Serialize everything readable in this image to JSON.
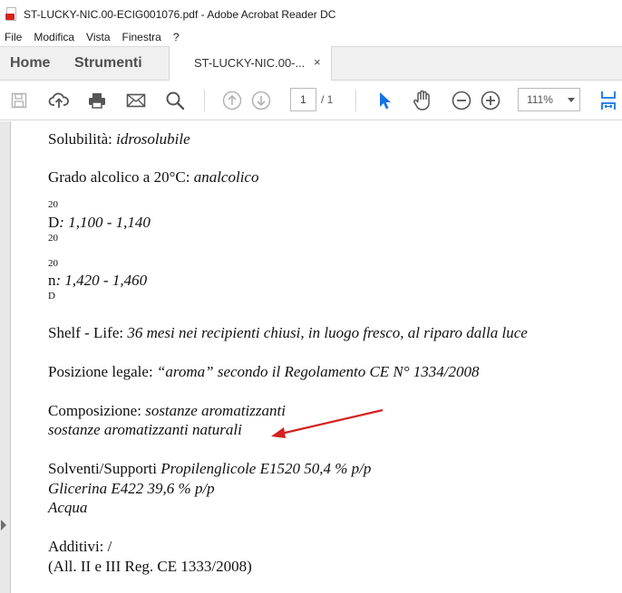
{
  "window": {
    "title": "ST-LUCKY-NIC.00-ECIG001076.pdf - Adobe Acrobat Reader DC"
  },
  "menu": [
    "File",
    "Modifica",
    "Vista",
    "Finestra",
    "?"
  ],
  "tabs": {
    "home": "Home",
    "tools": "Strumenti",
    "document": "ST-LUCKY-NIC.00-...",
    "close": "×"
  },
  "toolbar": {
    "icons": [
      "save-icon",
      "upload-cloud-icon",
      "print-icon",
      "email-icon",
      "search-icon",
      "prev-page-icon",
      "next-page-icon",
      "select-cursor-icon",
      "hand-tool-icon",
      "zoom-out-icon",
      "zoom-in-icon",
      "fit-page-icon"
    ],
    "page_current": "1",
    "page_total": "/ 1",
    "zoom": "111%",
    "accent_color": "#1473e6"
  },
  "document": {
    "solubility_label": "Solubilità: ",
    "solubility_value": "idrosolubile",
    "alcohol_label": "Grado alcolico a 20°C: ",
    "alcohol_value": "analcolico",
    "density_sup": "20",
    "density_symbol": "D",
    "density_value": ": 1,100 - 1,140",
    "density_sub": "20",
    "refraction_sup": "20",
    "refraction_symbol": "n",
    "refraction_value": ": 1,420 - 1,460",
    "refraction_sub": "D",
    "shelf_label": "Shelf - Life: ",
    "shelf_value": "36 mesi nei recipienti chiusi, in luogo fresco, al riparo dalla luce",
    "legal_label": "Posizione legale: ",
    "legal_value": "“aroma” secondo il Regolamento CE N° 1334/2008",
    "composition_label": "Composizione: ",
    "composition_value": "sostanze aromatizzanti",
    "composition_line2": "sostanze aromatizzanti naturali",
    "solvents_label": "Solventi/Supporti ",
    "solvents_value": "Propilenglicole E1520 50,4 % p/p",
    "solvents_line2": "Glicerina E422 39,6 % p/p",
    "solvents_line3": "Acqua",
    "additives_label": "Additivi: ",
    "additives_value": "/",
    "additives_line2": "(All. II e III Reg. CE 1333/2008)",
    "annotation_color": "#d42020"
  }
}
